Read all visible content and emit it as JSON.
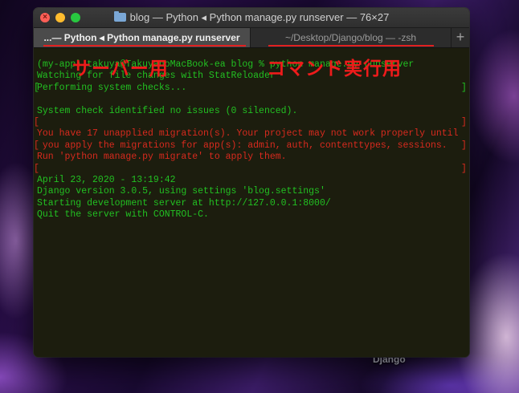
{
  "window": {
    "title": "blog — Python ◂ Python manage.py runserver — 76×27"
  },
  "tabs": [
    {
      "label": "...— Python ◂ Python manage.py runserver",
      "active": true
    },
    {
      "label": "~/Desktop/Django/blog — -zsh",
      "active": false
    }
  ],
  "tab_add_label": "+",
  "terminal": {
    "lines": [
      {
        "text": "(my-app) takuya@TakuyanoMacBook-ea blog % python manage.py runserver",
        "color": "green"
      },
      {
        "text": "Watching for file changes with StatReloader",
        "color": "green"
      },
      {
        "text": "Performing system checks...",
        "color": "green"
      },
      {
        "text": "",
        "color": "green"
      },
      {
        "text": "System check identified no issues (0 silenced).",
        "color": "green"
      },
      {
        "text": "",
        "color": "red"
      },
      {
        "text": "You have 17 unapplied migration(s). Your project may not work properly until",
        "color": "red"
      },
      {
        "text": " you apply the migrations for app(s): admin, auth, contenttypes, sessions.",
        "color": "red"
      },
      {
        "text": "Run 'python manage.py migrate' to apply them.",
        "color": "red"
      },
      {
        "text": "",
        "color": "red"
      },
      {
        "text": "April 23, 2020 - 13:19:42",
        "color": "green"
      },
      {
        "text": "Django version 3.0.5, using settings 'blog.settings'",
        "color": "green"
      },
      {
        "text": "Starting development server at http://127.0.0.1:8000/",
        "color": "green"
      },
      {
        "text": "Quit the server with CONTROL-C.",
        "color": "green"
      }
    ]
  },
  "annotations": {
    "server": "サーバー用",
    "command": "コマンド実行用"
  },
  "desktop": {
    "folder_label": "Django"
  },
  "colors": {
    "terminal_green": "#22c022",
    "terminal_red": "#d82a1e",
    "annotation_red": "#ee1b1b"
  }
}
